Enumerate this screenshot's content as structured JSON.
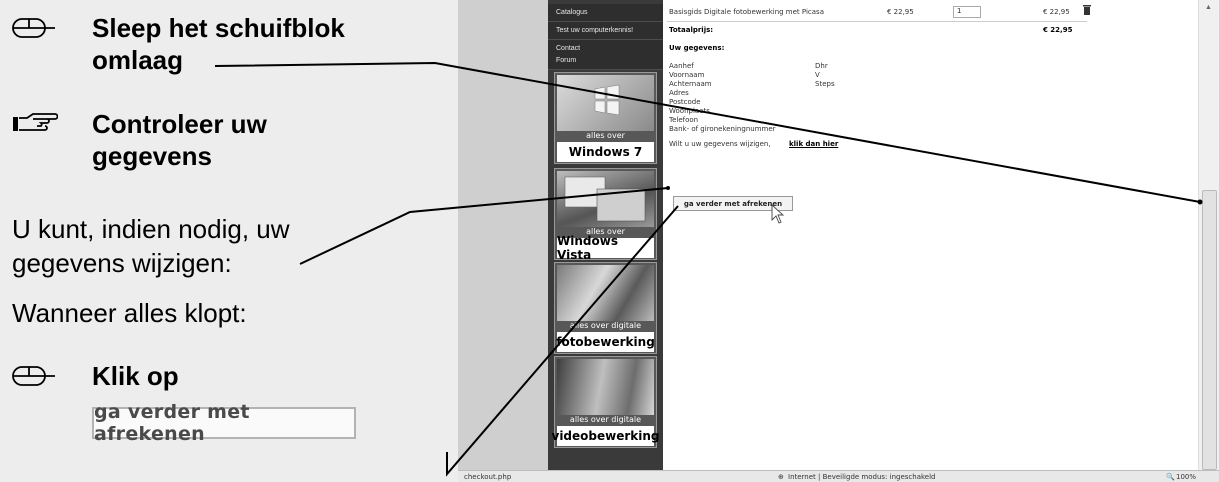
{
  "instructions": {
    "step1_text": "Sleep het schuifblok omlaag",
    "step2_text": "Controleer uw gegevens",
    "para1": "U kunt, indien nodig, uw gegevens wijzigen:",
    "para2": "Wanneer alles klopt:",
    "step3_text": "Klik op",
    "button_sample": "ga verder met afrekenen",
    "icons": {
      "mouse": "mouse-icon",
      "hand": "pointing-hand-icon"
    }
  },
  "sidebar": {
    "nav_items": [
      "Catalogus",
      "Test uw computerkennis!",
      "Contact",
      "Forum"
    ],
    "tiles": [
      {
        "tag": "alles over",
        "name": "Windows 7"
      },
      {
        "tag": "alles over",
        "name": "Windows Vista"
      },
      {
        "tag": "alles over digitale",
        "name": "fotobewerking"
      },
      {
        "tag": "alles over digitale",
        "name": "videobewerking"
      }
    ]
  },
  "order": {
    "product": "Basisgids Digitale fotobewerking met Picasa",
    "price": "€ 22,95",
    "qty": "1",
    "line_total": "€ 22,95",
    "total_label": "Totaalprijs:",
    "total": "€ 22,95"
  },
  "details": {
    "heading": "Uw gegevens:",
    "labels": [
      "Aanhef",
      "Voornaam",
      "Achternaam",
      "Adres",
      "Postcode",
      "Woonplaats",
      "Telefoon",
      "Bank- of gironekeningnummer"
    ],
    "values": [
      "Dhr",
      "V",
      "Steps"
    ],
    "change_text": "Wilt u uw gegevens wijzigen,",
    "change_link": "klik dan hier",
    "continue_button": "ga verder met afrekenen"
  },
  "statusbar": {
    "url": "checkout.php",
    "zone": "Internet | Beveiligde modus: ingeschakeld",
    "zoom": "100%"
  }
}
